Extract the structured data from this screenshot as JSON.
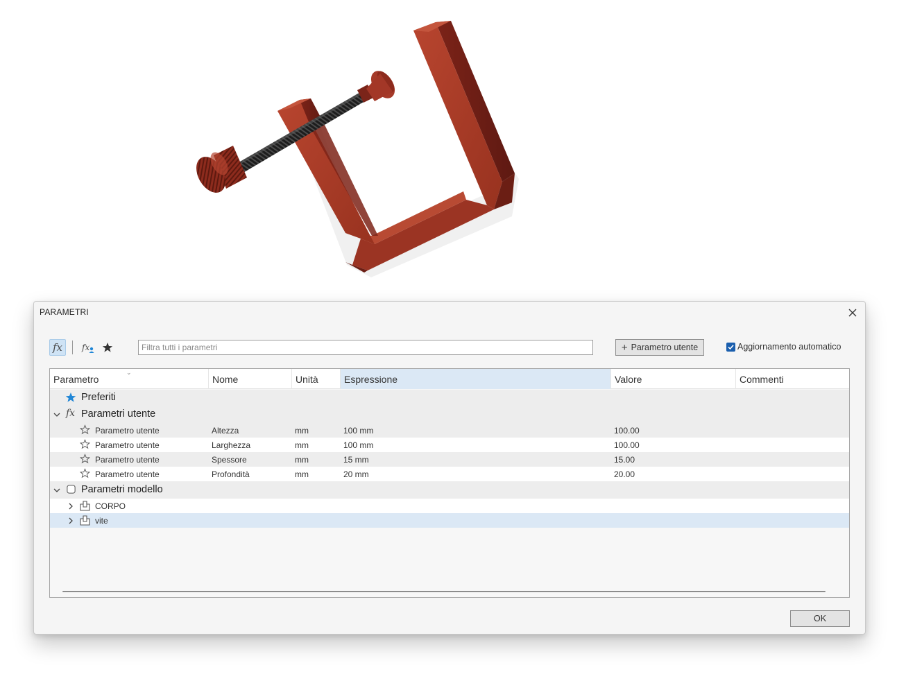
{
  "dialog": {
    "title": "PARAMETRI",
    "close_icon": "close-icon"
  },
  "toolbar": {
    "fx_icon": "fx-icon",
    "user_fx_icon": "fx-user-icon",
    "favorites_icon": "star-icon",
    "filter_placeholder": "Filtra tutti i parametri",
    "filter_value": "",
    "add_user_param_label": "Parametro utente",
    "auto_update_label": "Aggiornamento automatico",
    "auto_update_checked": true
  },
  "grid": {
    "columns": [
      "Parametro",
      "Nome",
      "Unità",
      "Espressione",
      "Valore",
      "Commenti"
    ],
    "sorted_column": "Espressione",
    "favorites_group": "Preferiti",
    "user_group": "Parametri utente",
    "user_params": [
      {
        "parameter": "Parametro utente",
        "name": "Altezza",
        "unit": "mm",
        "expression": "100 mm",
        "value": "100.00",
        "comment": ""
      },
      {
        "parameter": "Parametro utente",
        "name": "Larghezza",
        "unit": "mm",
        "expression": "100 mm",
        "value": "100.00",
        "comment": ""
      },
      {
        "parameter": "Parametro utente",
        "name": "Spessore",
        "unit": "mm",
        "expression": "15 mm",
        "value": "15.00",
        "comment": ""
      },
      {
        "parameter": "Parametro utente",
        "name": "Profondità",
        "unit": "mm",
        "expression": "20 mm",
        "value": "20.00",
        "comment": ""
      }
    ],
    "model_group": "Parametri modello",
    "model_components": [
      "CORPO",
      "vite"
    ],
    "selected_component": "vite"
  },
  "footer": {
    "ok_label": "OK"
  },
  "colors": {
    "clamp_red": "#a8392b",
    "selection_blue": "#dbe8f5",
    "accent_blue": "#1b5fae",
    "star_blue": "#1f86d6"
  }
}
